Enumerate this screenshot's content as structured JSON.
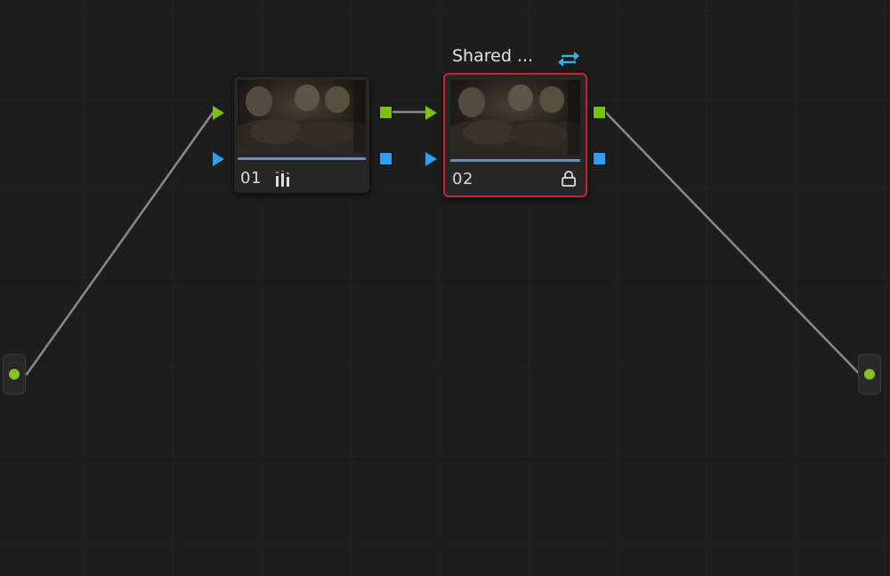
{
  "node_graph": {
    "colors": {
      "background": "#1d1d1e",
      "rgb_port": "#7cc012",
      "alpha_port": "#2f9ef5",
      "wire": "#8a8a8a",
      "selection": "#c0292e",
      "shared_icon": "#33b3ea"
    },
    "nodes": [
      {
        "label": "01",
        "badge_icon": "levels-bars-icon",
        "selected": false
      },
      {
        "label": "02",
        "badge_icon": "lock-icon",
        "selected": true,
        "group_title": "Shared ...",
        "group_icon": "swap-arrows-icon"
      }
    ],
    "source_input_icon": "source-dot-icon",
    "output_icon": "output-dot-icon"
  }
}
